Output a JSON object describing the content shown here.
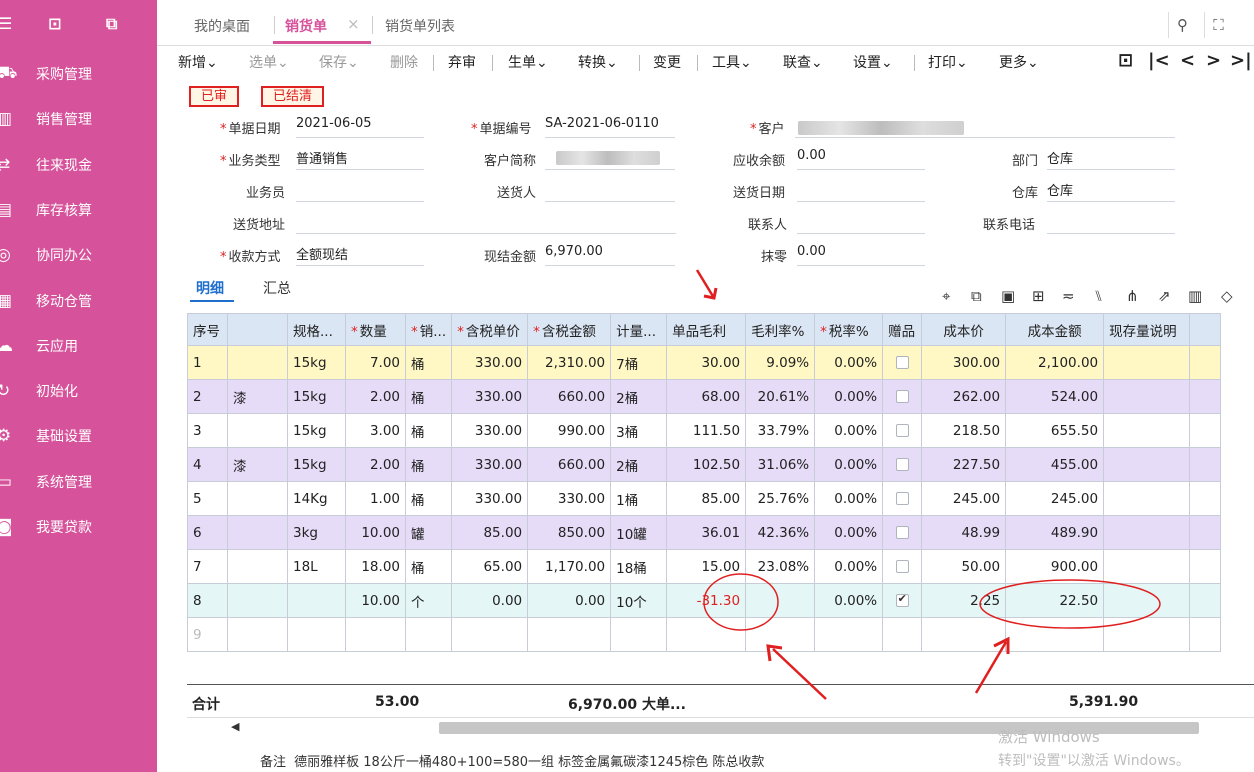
{
  "colors": {
    "sidebar": "#d6529b",
    "accent": "#d6529b",
    "link": "#1f6fcf",
    "danger": "#e02020"
  },
  "sidebar": {
    "top_icons": [
      "inspect-icon",
      "export-icon"
    ],
    "items": [
      {
        "label": "采购管理",
        "icon": "cart-icon"
      },
      {
        "label": "销售管理",
        "icon": "chart-icon"
      },
      {
        "label": "往来现金",
        "icon": "exchange-icon"
      },
      {
        "label": "库存核算",
        "icon": "stock-icon"
      },
      {
        "label": "协同办公",
        "icon": "team-icon"
      },
      {
        "label": "移动仓管",
        "icon": "mobile-icon"
      },
      {
        "label": "云应用",
        "icon": "cloud-icon"
      },
      {
        "label": "初始化",
        "icon": "reset-icon"
      },
      {
        "label": "基础设置",
        "icon": "settings-icon"
      },
      {
        "label": "系统管理",
        "icon": "monitor-icon"
      },
      {
        "label": "我要贷款",
        "icon": "loan-icon"
      }
    ]
  },
  "tabs": {
    "desktop": "我的桌面",
    "active": "销货单",
    "close": "×",
    "list": "销货单列表"
  },
  "toolbar": {
    "new": "新增",
    "select": "选单",
    "save": "保存",
    "delete": "删除",
    "unaudit": "弃审",
    "generate": "生单",
    "convert": "转换",
    "change": "变更",
    "tools": "工具",
    "query": "联查",
    "settings": "设置",
    "print": "打印",
    "more": "更多",
    "arrow": "⌄",
    "nav_first": "|<",
    "nav_prev": "<",
    "nav_next": ">",
    "nav_last": ">|"
  },
  "badges": {
    "audited": "已审",
    "settled": "已结清"
  },
  "form": {
    "doc_date_label": "单据日期",
    "doc_date": "2021-06-05",
    "doc_no_label": "单据编号",
    "doc_no": "SA-2021-06-0110",
    "customer_label": "客户",
    "customer": "",
    "biz_type_label": "业务类型",
    "biz_type": "普通销售",
    "cust_short_label": "客户简称",
    "cust_short": "",
    "receivable_label": "应收余额",
    "receivable": "0.00",
    "dept_label": "部门",
    "dept": "仓库",
    "salesman_label": "业务员",
    "salesman": "",
    "deliverer_label": "送货人",
    "deliverer": "",
    "delivery_date_label": "送货日期",
    "delivery_date": "",
    "warehouse_label": "仓库",
    "warehouse": "仓库",
    "address_label": "送货地址",
    "address": "",
    "contact_label": "联系人",
    "contact": "",
    "phone_label": "联系电话",
    "phone": "",
    "payment_label": "收款方式",
    "payment": "全额现结",
    "cash_amount_label": "现结金额",
    "cash_amount": "6,970.00",
    "rounding_label": "抹零",
    "rounding": "0.00",
    "req": "*"
  },
  "subtabs": {
    "detail": "明细",
    "summary": "汇总"
  },
  "grid": {
    "headers": [
      "序号",
      "",
      "规格...",
      "数量",
      "销...",
      "含税单价",
      "含税金额",
      "计量...",
      "单品毛利",
      "毛利率%",
      "税率%",
      "赠品",
      "成本价",
      "成本金额",
      "现存量说明"
    ],
    "rows": [
      {
        "idx": "1",
        "name": "",
        "spec": "15kg",
        "qty": "7.00",
        "unit": "桶",
        "price": "330.00",
        "amount": "2,310.00",
        "measure": "7桶",
        "profit": "30.00",
        "rate": "9.09%",
        "tax": "0.00%",
        "gift": false,
        "cost": "300.00",
        "cost_amount": "2,100.00",
        "note": ""
      },
      {
        "idx": "2",
        "name": "漆",
        "spec": "15kg",
        "qty": "2.00",
        "unit": "桶",
        "price": "330.00",
        "amount": "660.00",
        "measure": "2桶",
        "profit": "68.00",
        "rate": "20.61%",
        "tax": "0.00%",
        "gift": false,
        "cost": "262.00",
        "cost_amount": "524.00",
        "note": ""
      },
      {
        "idx": "3",
        "name": "",
        "spec": "15kg",
        "qty": "3.00",
        "unit": "桶",
        "price": "330.00",
        "amount": "990.00",
        "measure": "3桶",
        "profit": "111.50",
        "rate": "33.79%",
        "tax": "0.00%",
        "gift": false,
        "cost": "218.50",
        "cost_amount": "655.50",
        "note": ""
      },
      {
        "idx": "4",
        "name": "漆",
        "spec": "15kg",
        "qty": "2.00",
        "unit": "桶",
        "price": "330.00",
        "amount": "660.00",
        "measure": "2桶",
        "profit": "102.50",
        "rate": "31.06%",
        "tax": "0.00%",
        "gift": false,
        "cost": "227.50",
        "cost_amount": "455.00",
        "note": ""
      },
      {
        "idx": "5",
        "name": "",
        "spec": "14Kg",
        "qty": "1.00",
        "unit": "桶",
        "price": "330.00",
        "amount": "330.00",
        "measure": "1桶",
        "profit": "85.00",
        "rate": "25.76%",
        "tax": "0.00%",
        "gift": false,
        "cost": "245.00",
        "cost_amount": "245.00",
        "note": ""
      },
      {
        "idx": "6",
        "name": "",
        "spec": "3kg",
        "qty": "10.00",
        "unit": "罐",
        "price": "85.00",
        "amount": "850.00",
        "measure": "10罐",
        "profit": "36.01",
        "rate": "42.36%",
        "tax": "0.00%",
        "gift": false,
        "cost": "48.99",
        "cost_amount": "489.90",
        "note": ""
      },
      {
        "idx": "7",
        "name": "",
        "spec": "18L",
        "qty": "18.00",
        "unit": "桶",
        "price": "65.00",
        "amount": "1,170.00",
        "measure": "18桶",
        "profit": "15.00",
        "rate": "23.08%",
        "tax": "0.00%",
        "gift": false,
        "cost": "50.00",
        "cost_amount": "900.00",
        "note": ""
      },
      {
        "idx": "8",
        "name": "",
        "spec": "",
        "qty": "10.00",
        "unit": "个",
        "price": "0.00",
        "amount": "0.00",
        "measure": "10个",
        "profit": "-31.30",
        "rate": "",
        "tax": "0.00%",
        "gift": true,
        "cost": "2.25",
        "cost_amount": "22.50",
        "note": ""
      },
      {
        "idx": "9",
        "name": "",
        "spec": "",
        "qty": "",
        "unit": "",
        "price": "",
        "amount": "",
        "measure": "",
        "profit": "",
        "rate": "",
        "tax": "",
        "gift": null,
        "cost": "",
        "cost_amount": "",
        "note": ""
      }
    ]
  },
  "totals": {
    "label": "合计",
    "qty": "53.00",
    "amount": "6,970.00 大单...",
    "cost_amount": "5,391.90"
  },
  "remark": {
    "label": "备注",
    "text": "德丽雅样板 18公斤一桶480+100=580一组 标签金属氟碳漆1245棕色 陈总收款"
  },
  "watermark": {
    "line1": "激活 Windows",
    "line2": "转到\"设置\"以激活 Windows。"
  }
}
